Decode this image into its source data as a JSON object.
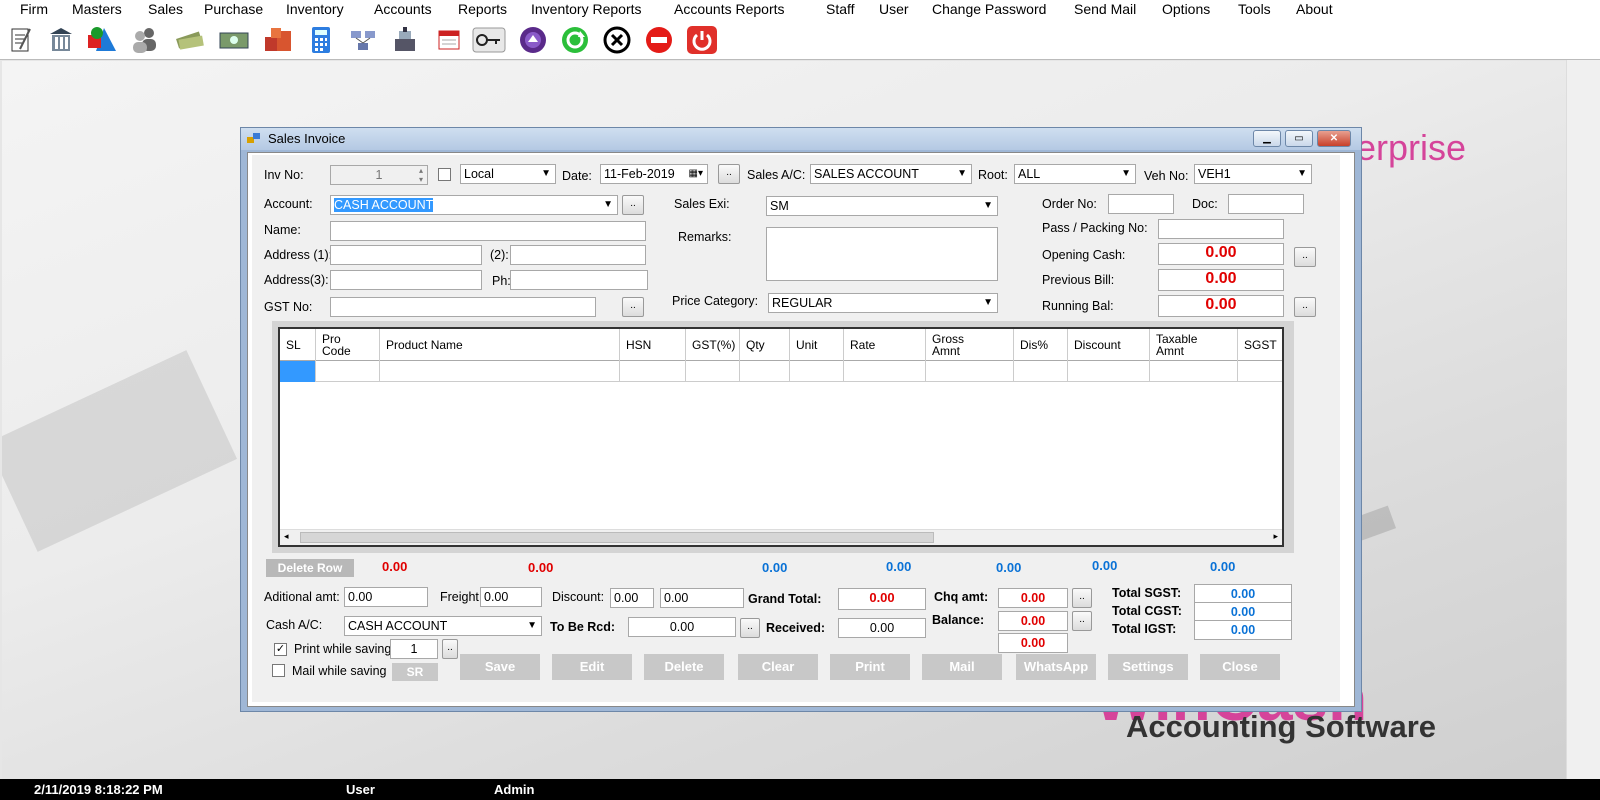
{
  "menu": [
    "Firm",
    "Masters",
    "Sales",
    "Purchase",
    "Inventory",
    "Accounts",
    "Reports",
    "Inventory Reports",
    "Accounts Reports",
    "Staff",
    "User",
    "Change Password",
    "Send Mail",
    "Options",
    "Tools",
    "About"
  ],
  "toolbar_icons": [
    "notepad-icon",
    "building-icon",
    "shapes-icon",
    "users-icon",
    "money-icon",
    "cash-note-icon",
    "boxes-icon",
    "calculator-icon",
    "network-icon",
    "cash-register-icon",
    "calendar-icon",
    "key-icon",
    "purple-round-icon",
    "green-refresh-icon",
    "close-circle-icon",
    "stop-icon",
    "power-icon"
  ],
  "background": {
    "brand_partial": "erprise",
    "logo_partial": "WinCash",
    "logo_tagline": "Accounting Software"
  },
  "window": {
    "title": "Sales Invoice",
    "inv_no_label": "Inv No:",
    "inv_no_value": "1",
    "local_value": "Local",
    "date_label": "Date:",
    "date_value": "11-Feb-2019",
    "sales_ac_label": "Sales A/C:",
    "sales_ac_value": "SALES ACCOUNT",
    "root_label": "Root:",
    "root_value": "ALL",
    "veh_label": "Veh No:",
    "veh_value": "VEH1",
    "account_label": "Account:",
    "account_value": "CASH ACCOUNT",
    "name_label": "Name:",
    "address1_label": "Address (1):",
    "address2_label": "(2):",
    "address3_label": "Address(3):",
    "ph_label": "Ph:",
    "gst_label": "GST No:",
    "sales_exi_label": "Sales Exi:",
    "sales_exi_value": "SM",
    "remarks_label": "Remarks:",
    "price_cat_label": "Price Category:",
    "price_cat_value": "REGULAR",
    "order_label": "Order No:",
    "doc_label": "Doc:",
    "pass_label": "Pass / Packing No:",
    "opening_label": "Opening Cash:",
    "opening_value": "0.00",
    "prevbill_label": "Previous Bill:",
    "prevbill_value": "0.00",
    "running_label": "Running Bal:",
    "running_value": "0.00",
    "dots": "..",
    "grid": {
      "headers": [
        "SL",
        "Pro\nCode",
        "Product Name",
        "HSN",
        "GST(%)",
        "Qty",
        "Unit",
        "Rate",
        "Gross\nAmnt",
        "Dis%",
        "Discount",
        "Taxable\nAmnt",
        "SGST"
      ]
    },
    "delete_row": "Delete Row",
    "totals_red": [
      "0.00",
      "0.00"
    ],
    "totals_blue": [
      "0.00",
      "0.00",
      "0.00",
      "0.00",
      "0.00"
    ],
    "add_amt_label": "Aditional amt:",
    "add_amt_value": "0.00",
    "freight_label": "Freight:",
    "freight_value": "0.00",
    "discount_label": "Discount:",
    "discount_value1": "0.00",
    "discount_value2": "0.00",
    "grand_total_label": "Grand Total:",
    "grand_total_value": "0.00",
    "chq_label": "Chq amt:",
    "chq_value": "0.00",
    "balance_label": "Balance:",
    "balance_value1": "0.00",
    "balance_value2": "0.00",
    "cash_ac_label": "Cash A/C:",
    "cash_ac_value": "CASH ACCOUNT",
    "to_be_rcd_label": "To Be Rcd:",
    "to_be_rcd_value": "0.00",
    "received_label": "Received:",
    "received_value": "0.00",
    "total_sgst_label": "Total SGST:",
    "total_sgst_value": "0.00",
    "total_cgst_label": "Total CGST:",
    "total_cgst_value": "0.00",
    "total_igst_label": "Total IGST:",
    "total_igst_value": "0.00",
    "print_while_saving": "Print while saving",
    "print_copies": "1",
    "mail_while_saving": "Mail while saving",
    "sr": "SR",
    "buttons": [
      "Save",
      "Edit",
      "Delete",
      "Clear",
      "Print",
      "Mail",
      "WhatsApp",
      "Settings",
      "Close"
    ]
  },
  "status": {
    "datetime": "2/11/2019 8:18:22 PM",
    "user_label": "User",
    "user_value": "Admin"
  }
}
